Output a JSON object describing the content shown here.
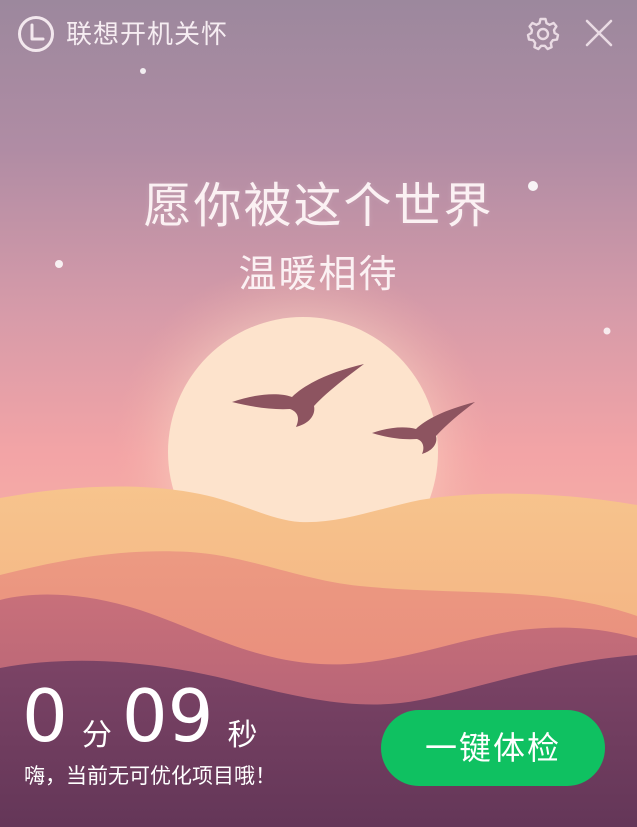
{
  "app": {
    "title": "联想开机关怀"
  },
  "slogan": {
    "line1": "愿你被这个世界",
    "line2": "温暖相待"
  },
  "timer": {
    "minutes": "0",
    "minutes_unit": "分",
    "seconds": "09",
    "seconds_unit": "秒"
  },
  "status": {
    "message": "嗨，当前无可优化项目哦！"
  },
  "actions": {
    "checkup_label": "一键体检"
  },
  "icons": {
    "logo": "clock-icon",
    "settings": "gear-icon",
    "close": "close-icon"
  },
  "colors": {
    "accent_button": "#0fc161",
    "sky_top": "#a1889e",
    "sky_mid": "#e79a9c",
    "sun": "#fde3cc",
    "bird": "#8d5460",
    "hill_dark": "#6b3a5e"
  }
}
